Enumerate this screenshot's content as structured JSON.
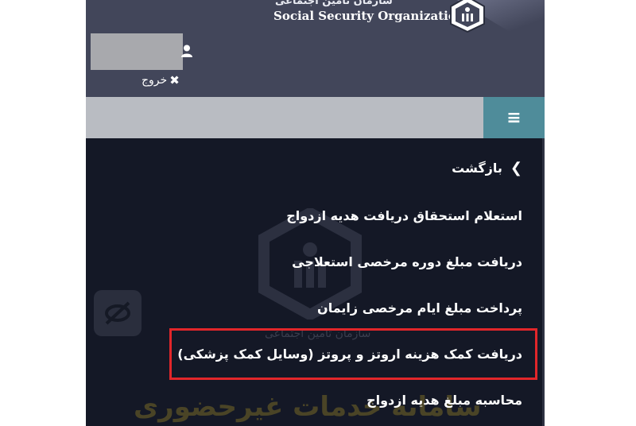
{
  "header": {
    "org_name_en": "Social Security Organization",
    "org_name_fa": "سازمان تامین اجتماعی",
    "logout_label": "خروج",
    "logout_icon": "close-icon"
  },
  "menu": {
    "back_label": "بازگشت",
    "items": [
      "استعلام استحقاق دریافت هدیه ازدواج",
      "دریافت مبلغ دوره مرخصی استعلاجی",
      "پرداخت مبلغ ایام مرخصی زایمان",
      "دریافت کمک هزینه اروتز و پروتز (وسایل کمک پزشکی)",
      "محاسبه مبلغ هدیه ازدواج"
    ]
  },
  "background": {
    "watermark_small": "سازمان تامین اجتماعی",
    "watermark_large": "سامانه خدمات غیرحضوری"
  },
  "colors": {
    "header_bg": "#42465a",
    "body_bg": "#141826",
    "toolbar_bg": "#b9bcc2",
    "menu_toggle_bg": "#4f8c9a",
    "highlight": "#e2262a"
  }
}
